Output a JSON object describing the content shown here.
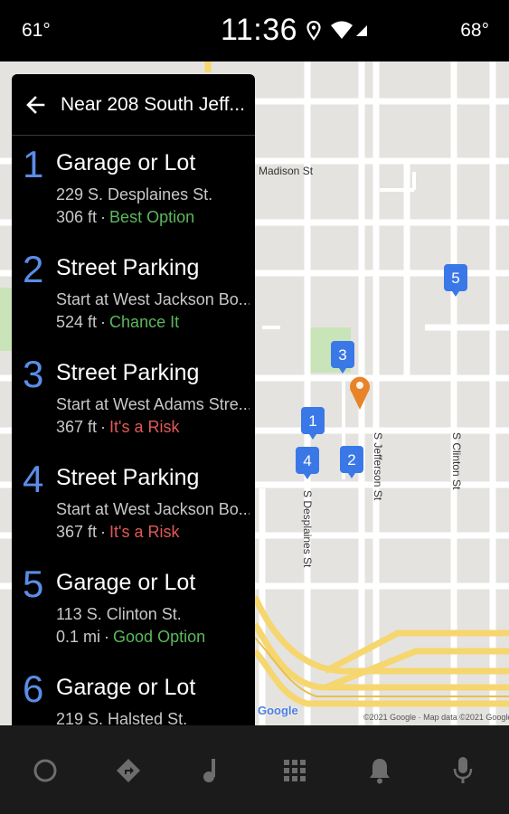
{
  "status_bar": {
    "temp_left": "61°",
    "clock": "11:36",
    "temp_right": "68°"
  },
  "panel": {
    "title": "Near 208 South Jeff..."
  },
  "results": [
    {
      "number": "1",
      "title": "Garage or Lot",
      "address": "229 S. Desplaines St.",
      "distance": "306 ft",
      "separator": "·",
      "rating": "Best Option",
      "rating_color": "#5cb85c"
    },
    {
      "number": "2",
      "title": "Street Parking",
      "address": "Start at West Jackson Bo...",
      "distance": "524 ft",
      "separator": "·",
      "rating": "Chance It",
      "rating_color": "#5cb85c"
    },
    {
      "number": "3",
      "title": "Street Parking",
      "address": "Start at West Adams Stre...",
      "distance": "367 ft",
      "separator": "·",
      "rating": "It's a Risk",
      "rating_color": "#e05a55"
    },
    {
      "number": "4",
      "title": "Street Parking",
      "address": "Start at West Jackson Bo...",
      "distance": "367 ft",
      "separator": "·",
      "rating": "It's a Risk",
      "rating_color": "#e05a55"
    },
    {
      "number": "5",
      "title": "Garage or Lot",
      "address": "113 S. Clinton St.",
      "distance": "0.1 mi",
      "separator": "·",
      "rating": "Good Option",
      "rating_color": "#5cb85c"
    },
    {
      "number": "6",
      "title": "Garage or Lot",
      "address": "219 S. Halsted St.",
      "distance": "",
      "separator": "",
      "rating": "",
      "rating_color": "#5cb85c"
    }
  ],
  "map": {
    "street_labels": {
      "madison": "Madison St",
      "desplaines": "S Desplaines St",
      "jefferson": "S Jefferson St",
      "clinton": "S Clinton St"
    },
    "pins": [
      "1",
      "2",
      "3",
      "4",
      "5"
    ],
    "google_logo": "Google",
    "copyright": "©2021 Google · Map data ©2021 Google"
  },
  "colors": {
    "pin_blue": "#3b78e7",
    "pin_orange": "#e8832a",
    "number_blue": "#5b8de8",
    "road_yellow": "#f6d66f"
  },
  "bottom_nav": [
    {
      "name": "home-icon"
    },
    {
      "name": "navigation-icon"
    },
    {
      "name": "music-icon"
    },
    {
      "name": "app-grid-icon"
    },
    {
      "name": "notifications-icon"
    },
    {
      "name": "microphone-icon"
    }
  ]
}
